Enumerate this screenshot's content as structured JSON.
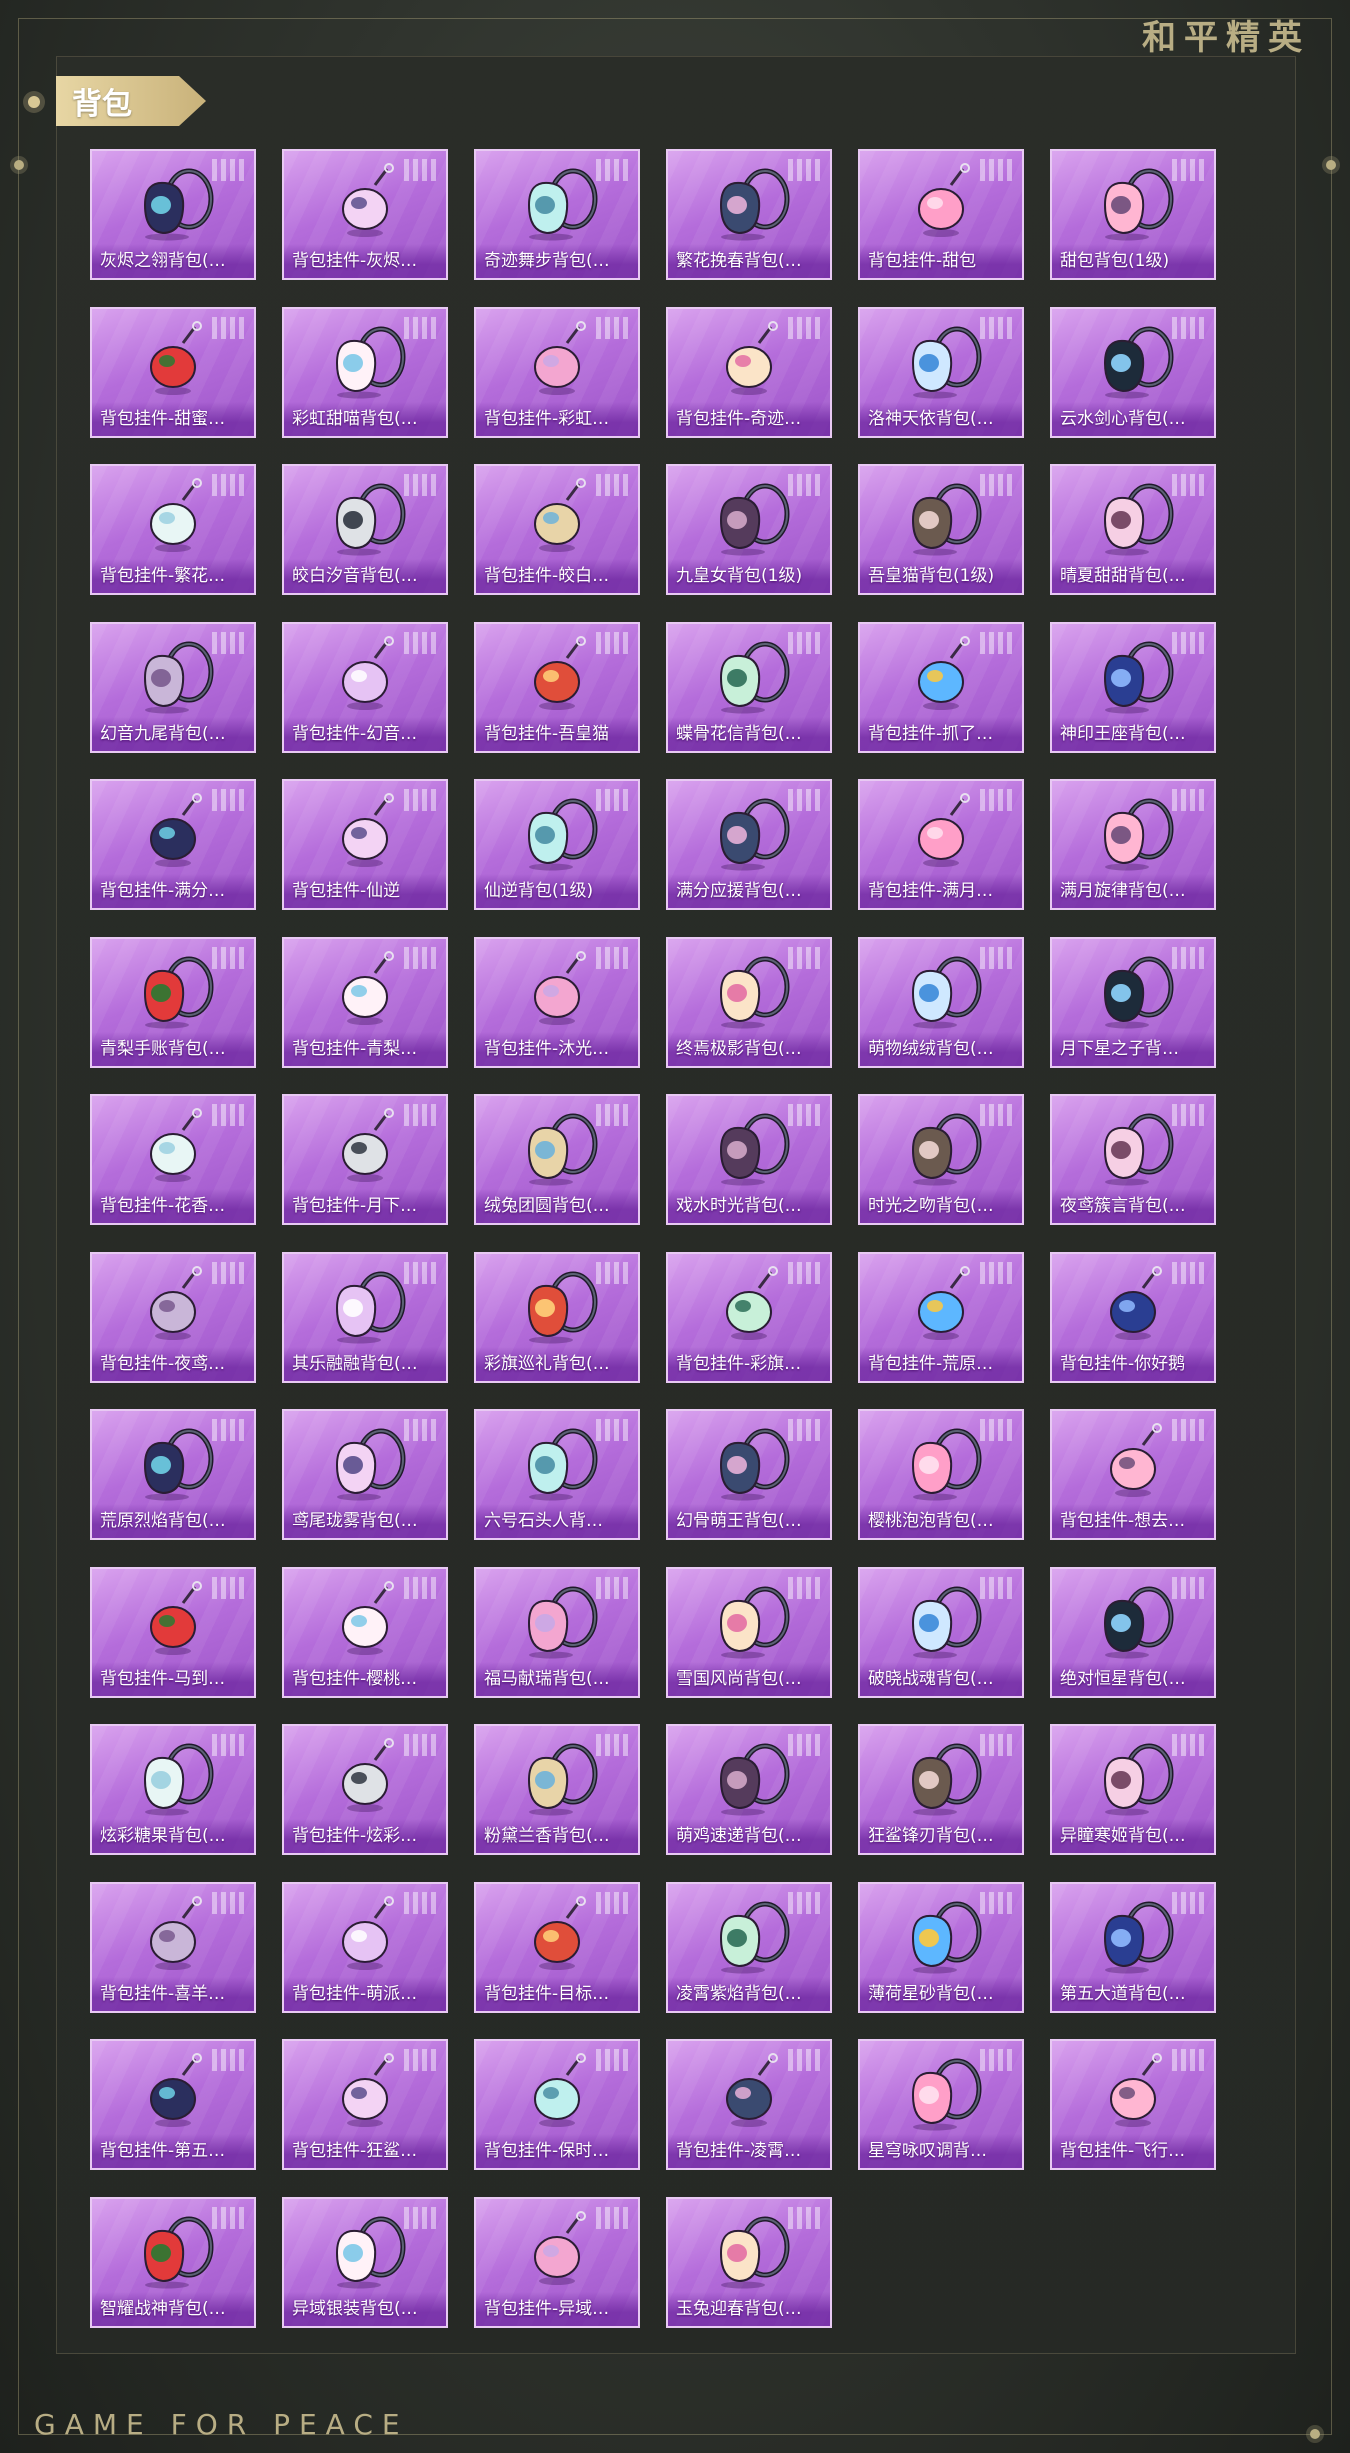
{
  "header": {
    "brand": "和平精英",
    "section_title": "背包"
  },
  "footer": {
    "slogan": "GAME FOR PEACE"
  },
  "colors": {
    "card_purple": "#b56ddb",
    "gold": "#c9b27a",
    "panel": "#2a2d28"
  },
  "items": [
    "灰烬之翎背包(…",
    "背包挂件-灰烬…",
    "奇迹舞步背包(…",
    "繁花挽春背包(…",
    "背包挂件-甜包",
    "甜包背包(1级)",
    "背包挂件-甜蜜…",
    "彩虹甜喵背包(…",
    "背包挂件-彩虹…",
    "背包挂件-奇迹…",
    "洛神天依背包(…",
    "云水剑心背包(…",
    "背包挂件-繁花…",
    "皎白汐音背包(…",
    "背包挂件-皎白…",
    "九皇女背包(1级)",
    "吾皇猫背包(1级)",
    "晴夏甜甜背包(…",
    "幻音九尾背包(…",
    "背包挂件-幻音…",
    "背包挂件-吾皇猫",
    "蝶骨花信背包(…",
    "背包挂件-抓了…",
    "神印王座背包(…",
    "背包挂件-满分…",
    "背包挂件-仙逆",
    "仙逆背包(1级)",
    "满分应援背包(…",
    "背包挂件-满月…",
    "满月旋律背包(…",
    "青梨手账背包(…",
    "背包挂件-青梨…",
    "背包挂件-沐光…",
    "终焉极影背包(…",
    "萌物绒绒背包(…",
    "月下星之子背…",
    "背包挂件-花香…",
    "背包挂件-月下…",
    "绒兔团圆背包(…",
    "戏水时光背包(…",
    "时光之吻背包(…",
    "夜鸢簇言背包(…",
    "背包挂件-夜鸢…",
    "其乐融融背包(…",
    "彩旗巡礼背包(…",
    "背包挂件-彩旗…",
    "背包挂件-荒原…",
    "背包挂件-你好鹅",
    "荒原烈焰背包(…",
    "鸢尾珑雾背包(…",
    "六号石头人背…",
    "幻骨萌王背包(…",
    "樱桃泡泡背包(…",
    "背包挂件-想去…",
    "背包挂件-马到…",
    "背包挂件-樱桃…",
    "福马献瑞背包(…",
    "雪国风尚背包(…",
    "破晓战魂背包(…",
    "绝对恒星背包(…",
    "炫彩糖果背包(…",
    "背包挂件-炫彩…",
    "粉黛兰香背包(…",
    "萌鸡速递背包(…",
    "狂鲨锋刃背包(…",
    "异瞳寒姬背包(…",
    "背包挂件-喜羊…",
    "背包挂件-萌派…",
    "背包挂件-目标…",
    "凌霄紫焰背包(…",
    "薄荷星砂背包(…",
    "第五大道背包(…",
    "背包挂件-第五…",
    "背包挂件-狂鲨…",
    "背包挂件-保时…",
    "背包挂件-凌霄…",
    "星穹咏叹调背…",
    "背包挂件-飞行…",
    "智耀战神背包(…",
    "异域银装背包(…",
    "背包挂件-异域…",
    "玉兔迎春背包(…"
  ]
}
